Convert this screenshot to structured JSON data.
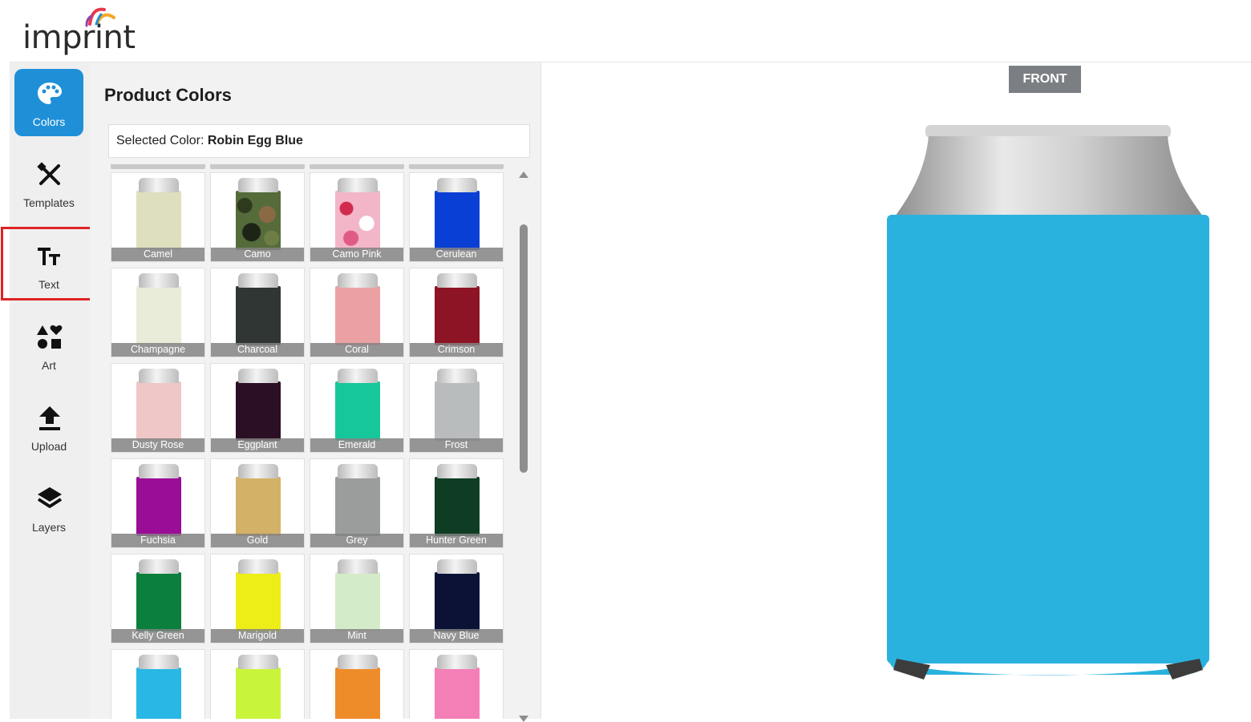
{
  "brand": {
    "logo_text": "imprint",
    "swoosh_colors": [
      "#e8384f",
      "#f5a623",
      "#1f90d8",
      "#8e44ad"
    ]
  },
  "sidebar": {
    "items": [
      {
        "id": "colors",
        "label": "Colors",
        "icon": "palette-icon",
        "active": true
      },
      {
        "id": "templates",
        "label": "Templates",
        "icon": "pencil-ruler-icon",
        "active": false
      },
      {
        "id": "text",
        "label": "Text",
        "icon": "text-size-icon",
        "active": false
      },
      {
        "id": "art",
        "label": "Art",
        "icon": "shapes-icon",
        "active": false
      },
      {
        "id": "upload",
        "label": "Upload",
        "icon": "upload-icon",
        "active": false
      },
      {
        "id": "layers",
        "label": "Layers",
        "icon": "layers-icon",
        "active": false
      }
    ],
    "accent": "#1f90d8"
  },
  "panel": {
    "title": "Product Colors",
    "selected_label": "Selected Color:",
    "selected_value": "Robin Egg Blue"
  },
  "colors": [
    {
      "name": "Camel",
      "hex": "#dedfbf"
    },
    {
      "name": "Camo",
      "hex": "#556b3a",
      "pattern": "camo"
    },
    {
      "name": "Camo Pink",
      "hex": "#f2b6c8",
      "pattern": "camo-pink"
    },
    {
      "name": "Cerulean",
      "hex": "#0a3fd6"
    },
    {
      "name": "Champagne",
      "hex": "#e9ecd8"
    },
    {
      "name": "Charcoal",
      "hex": "#2f3634"
    },
    {
      "name": "Coral",
      "hex": "#eba1a3"
    },
    {
      "name": "Crimson",
      "hex": "#8d1424"
    },
    {
      "name": "Dusty Rose",
      "hex": "#efc7c6"
    },
    {
      "name": "Eggplant",
      "hex": "#2b0f24"
    },
    {
      "name": "Emerald",
      "hex": "#17c79c"
    },
    {
      "name": "Frost",
      "hex": "#b9bcbd"
    },
    {
      "name": "Fuchsia",
      "hex": "#9a0d97"
    },
    {
      "name": "Gold",
      "hex": "#d3b167"
    },
    {
      "name": "Grey",
      "hex": "#9b9d9c"
    },
    {
      "name": "Hunter Green",
      "hex": "#0f3d23"
    },
    {
      "name": "Kelly Green",
      "hex": "#0b7f3e"
    },
    {
      "name": "Marigold",
      "hex": "#eded17"
    },
    {
      "name": "Mint",
      "hex": "#d4ebc8"
    },
    {
      "name": "Navy Blue",
      "hex": "#0b1236"
    },
    {
      "name": "",
      "hex": "#29b7e6"
    },
    {
      "name": "",
      "hex": "#c8f53a"
    },
    {
      "name": "",
      "hex": "#ef8c2a"
    },
    {
      "name": "",
      "hex": "#f47fb7"
    }
  ],
  "preview": {
    "side_label": "FRONT",
    "product_color": "#2ab2df"
  }
}
